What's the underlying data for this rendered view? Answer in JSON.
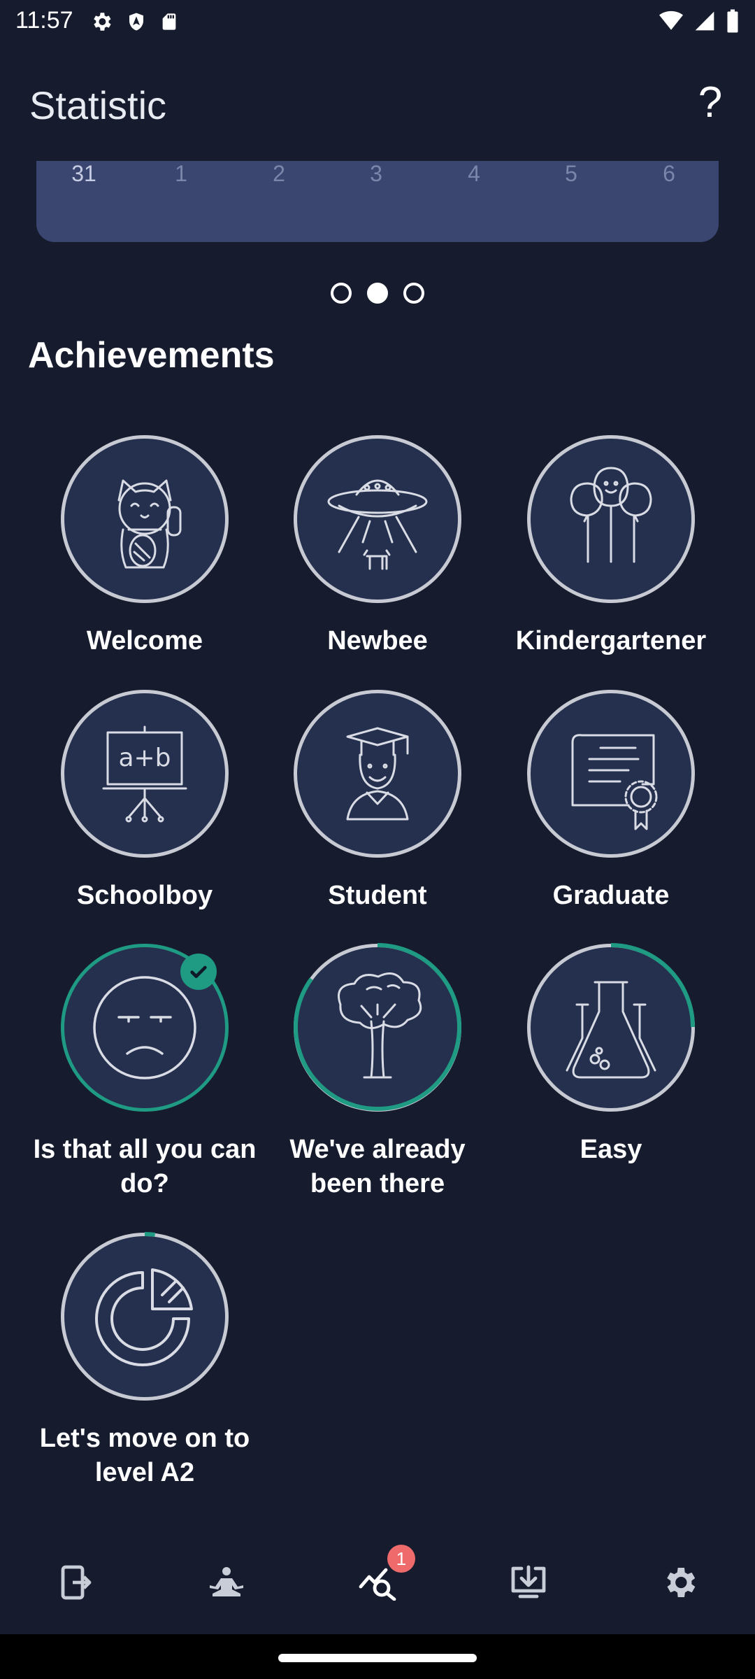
{
  "status_bar": {
    "time": "11:57",
    "icons_left": [
      "gear-icon",
      "shield-icon",
      "sd-card-icon"
    ],
    "icons_right": [
      "wifi-icon",
      "signal-icon",
      "battery-icon"
    ]
  },
  "app_bar": {
    "title": "Statistic",
    "help_label": "?"
  },
  "calendar": {
    "days": [
      "31",
      "1",
      "2",
      "3",
      "4",
      "5",
      "6"
    ]
  },
  "pager": {
    "pages": 3,
    "active_index": 1
  },
  "achievements_section": {
    "title": "Achievements",
    "items": [
      {
        "label": "Welcome",
        "icon": "lucky-cat-icon",
        "completed": false,
        "progress": 0
      },
      {
        "label": "Newbee",
        "icon": "ufo-icon",
        "completed": false,
        "progress": 0
      },
      {
        "label": "Kindergartener",
        "icon": "balloons-icon",
        "completed": false,
        "progress": 0
      },
      {
        "label": "Schoolboy",
        "icon": "whiteboard-icon",
        "completed": false,
        "progress": 0
      },
      {
        "label": "Student",
        "icon": "graduate-student-icon",
        "completed": false,
        "progress": 0
      },
      {
        "label": "Graduate",
        "icon": "diploma-icon",
        "completed": false,
        "progress": 0
      },
      {
        "label": "Is that all you can do?",
        "icon": "unimpressed-face-icon",
        "completed": true,
        "progress": 1.0
      },
      {
        "label": "We've already been there",
        "icon": "tree-icon",
        "completed": false,
        "progress": 0.85
      },
      {
        "label": "Easy",
        "icon": "flask-icon",
        "completed": false,
        "progress": 0.25
      },
      {
        "label": "Let's move on to level A2",
        "icon": "pie-chart-icon",
        "completed": false,
        "progress": 0.02
      }
    ]
  },
  "bottom_nav": {
    "items": [
      {
        "name": "cards",
        "icon": "card-arrow-icon"
      },
      {
        "name": "training",
        "icon": "meditation-icon"
      },
      {
        "name": "statistic",
        "icon": "stats-search-icon",
        "badge": "1",
        "active": true
      },
      {
        "name": "download",
        "icon": "download-icon"
      },
      {
        "name": "settings",
        "icon": "gear-icon"
      }
    ]
  },
  "colors": {
    "background": "#161c2e",
    "card": "#3a4670",
    "circle_fill": "#25304f",
    "circle_border": "#c7cad3",
    "progress": "#1f9a83",
    "badge": "#ef6b6b"
  }
}
